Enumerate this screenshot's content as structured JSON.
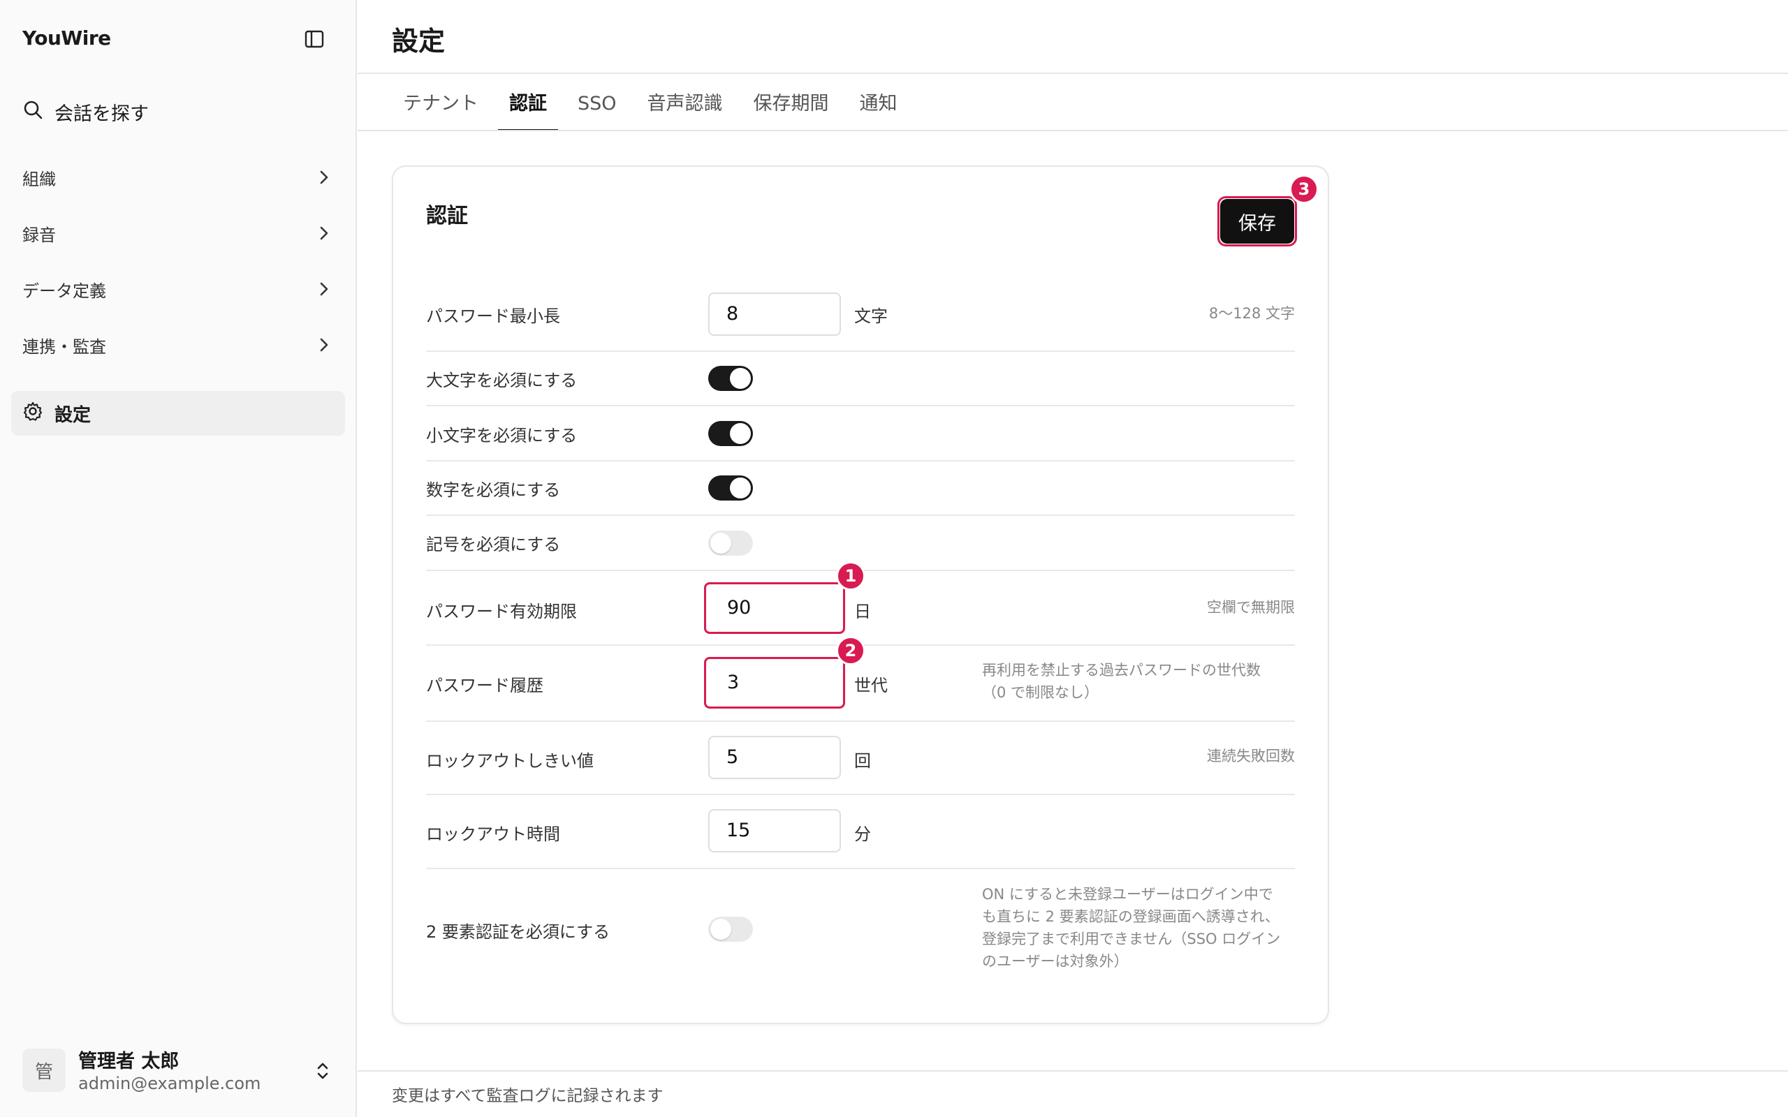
{
  "sidebar": {
    "brand": "YouWire",
    "search_label": "会話を探す",
    "items": [
      {
        "label": "組織"
      },
      {
        "label": "録音"
      },
      {
        "label": "データ定義"
      },
      {
        "label": "連携・監査"
      }
    ],
    "settings_label": "設定",
    "user": {
      "avatar_char": "管",
      "name": "管理者 太郎",
      "email": "admin@example.com"
    }
  },
  "header": {
    "title": "設定",
    "tabs": [
      {
        "label": "テナント",
        "active": false
      },
      {
        "label": "認証",
        "active": true
      },
      {
        "label": "SSO",
        "active": false
      },
      {
        "label": "音声認識",
        "active": false
      },
      {
        "label": "保存期間",
        "active": false
      },
      {
        "label": "通知",
        "active": false
      }
    ]
  },
  "card": {
    "title": "認証",
    "save_label": "保存",
    "markers": [
      "1",
      "2",
      "3"
    ],
    "rows": {
      "min_length": {
        "label": "パスワード最小長",
        "value": "8",
        "unit": "文字",
        "hint": "8〜128 文字"
      },
      "uppercase": {
        "label": "大文字を必須にする",
        "enabled": true
      },
      "lowercase": {
        "label": "小文字を必須にする",
        "enabled": true
      },
      "digits": {
        "label": "数字を必須にする",
        "enabled": true
      },
      "symbols": {
        "label": "記号を必須にする",
        "enabled": false
      },
      "expiry": {
        "label": "パスワード有効期限",
        "value": "90",
        "unit": "日",
        "hint": "空欄で無期限"
      },
      "history": {
        "label": "パスワード履歴",
        "value": "3",
        "unit": "世代",
        "hint_line1": "再利用を禁止する過去パスワードの世代数",
        "hint_line2": "（0 で制限なし）"
      },
      "lockout_threshold": {
        "label": "ロックアウトしきい値",
        "value": "5",
        "unit": "回",
        "hint": "連続失敗回数"
      },
      "lockout_duration": {
        "label": "ロックアウト時間",
        "value": "15",
        "unit": "分"
      },
      "mfa": {
        "label": "2 要素認証を必須にする",
        "enabled": false,
        "hint_line1": "ON にすると未登録ユーザーはログイン中で",
        "hint_line2": "も直ちに 2 要素認証の登録画面へ誘導され、",
        "hint_line3": "登録完了まで利用できません（SSO ログイン",
        "hint_line4": "のユーザーは対象外）"
      }
    }
  },
  "footer": {
    "note": "変更はすべて監査ログに記録されます"
  }
}
